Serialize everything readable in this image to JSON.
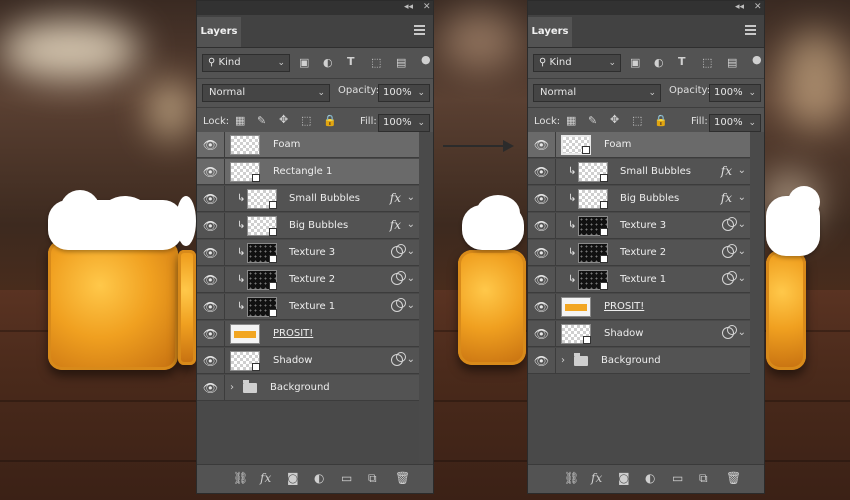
{
  "panel_left": {
    "tab_label": "Layers",
    "collapse_symbol": "◂◂",
    "close_symbol": "✕",
    "filter_kind": "Kind",
    "blend_mode": "Normal",
    "opacity_label": "Opacity:",
    "opacity_value": "100%",
    "lock_label": "Lock:",
    "fill_label": "Fill:",
    "fill_value": "100%",
    "layers": [
      {
        "name": "Foam"
      },
      {
        "name": "Rectangle 1"
      },
      {
        "name": "Small Bubbles",
        "fx": "fx"
      },
      {
        "name": "Big Bubbles",
        "fx": "fx"
      },
      {
        "name": "Texture 3"
      },
      {
        "name": "Texture 2"
      },
      {
        "name": "Texture 1"
      },
      {
        "name": "PROSIT!"
      },
      {
        "name": "Shadow"
      },
      {
        "name": "Background"
      }
    ]
  },
  "panel_right": {
    "tab_label": "Layers",
    "collapse_symbol": "◂◂",
    "close_symbol": "✕",
    "filter_kind": "Kind",
    "blend_mode": "Normal",
    "opacity_label": "Opacity:",
    "opacity_value": "100%",
    "lock_label": "Lock:",
    "fill_label": "Fill:",
    "fill_value": "100%",
    "layers": [
      {
        "name": "Foam"
      },
      {
        "name": "Small Bubbles",
        "fx": "fx"
      },
      {
        "name": "Big Bubbles",
        "fx": "fx"
      },
      {
        "name": "Texture 3"
      },
      {
        "name": "Texture 2"
      },
      {
        "name": "Texture 1"
      },
      {
        "name": "PROSIT!"
      },
      {
        "name": "Shadow"
      },
      {
        "name": "Background"
      }
    ]
  },
  "icons": {
    "eye": "visibility-eye-icon",
    "clip": "clipping-arrow-icon",
    "adjust": "adjustment-icon",
    "folder": "folder-icon",
    "link": "link-icon"
  },
  "colors": {
    "panel_bg": "#535353",
    "selected_row": "#6a6a6a",
    "beer_orange": "#f2a622"
  }
}
